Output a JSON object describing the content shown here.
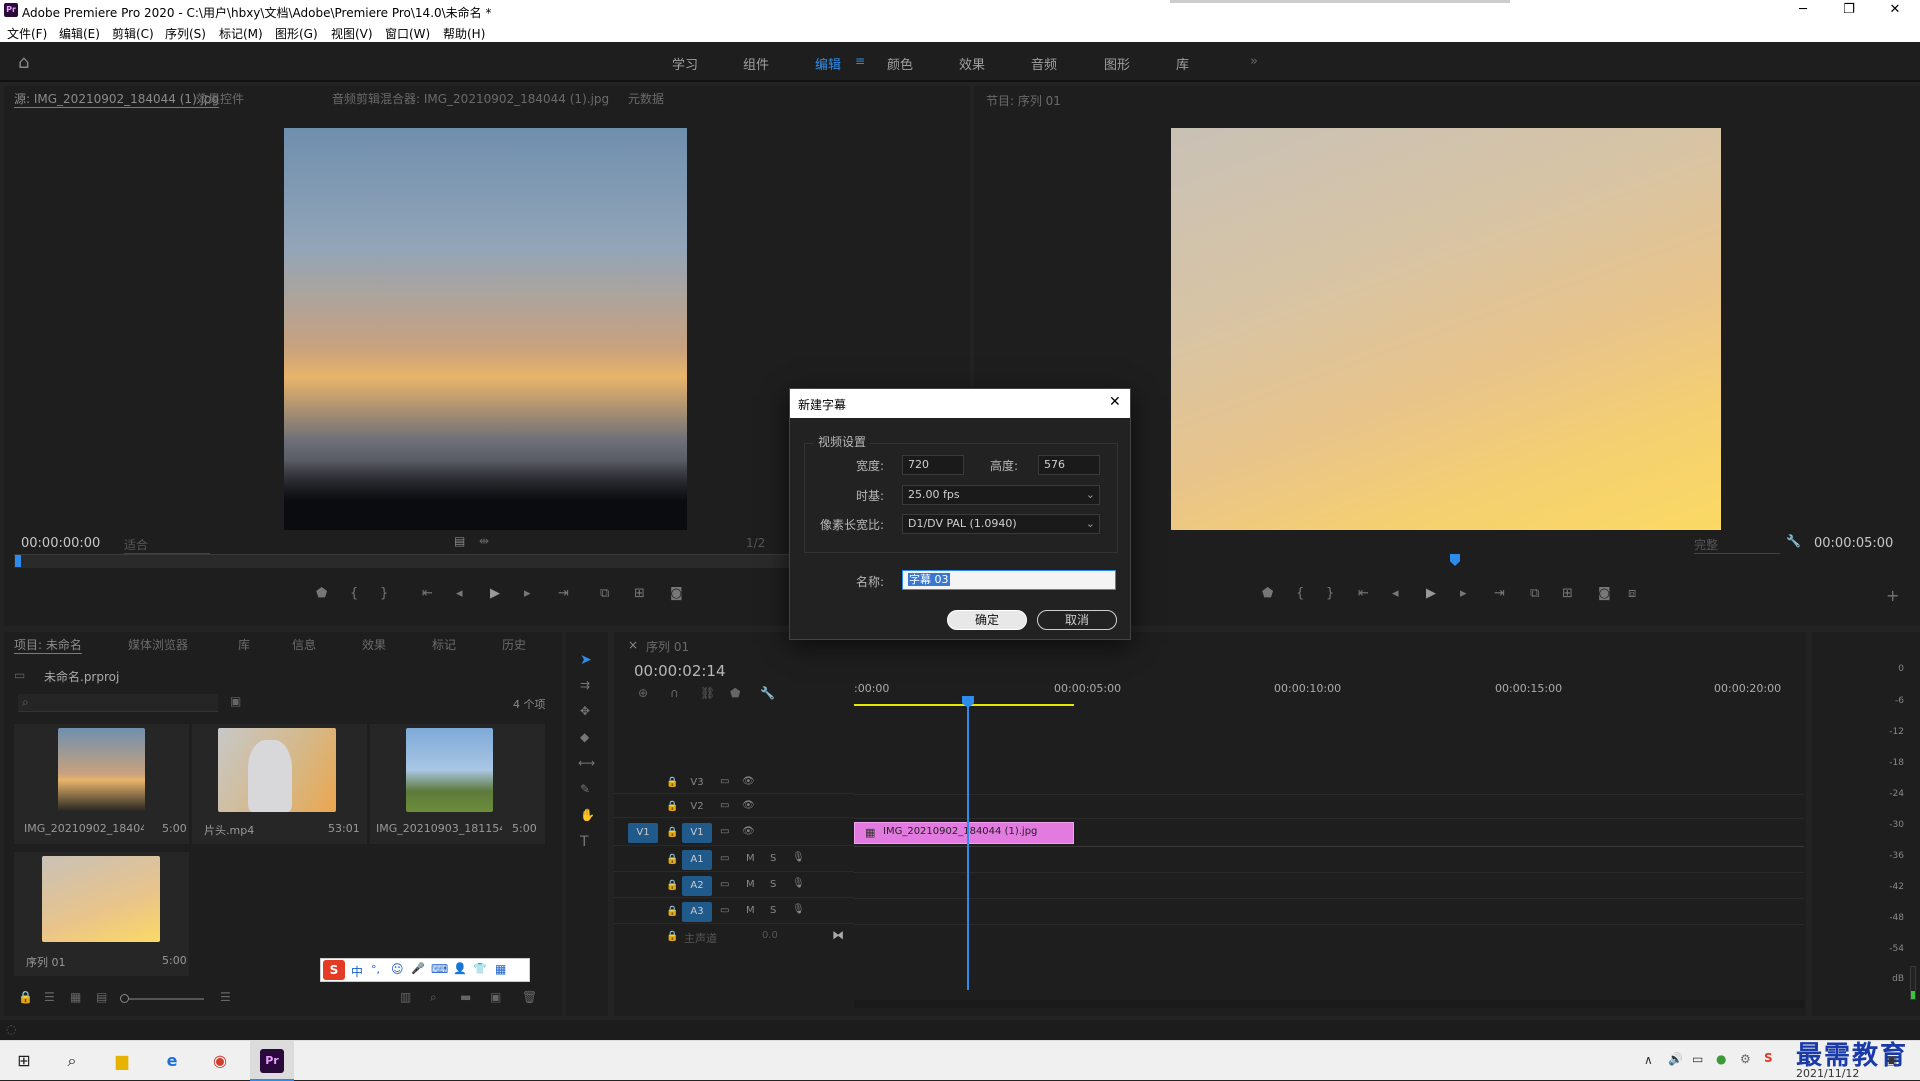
{
  "window": {
    "title": "Adobe Premiere Pro 2020 - C:\\用户\\hbxy\\文档\\Adobe\\Premiere Pro\\14.0\\未命名 *",
    "app_icon": "Pr"
  },
  "menu": [
    "文件(F)",
    "编辑(E)",
    "剪辑(C)",
    "序列(S)",
    "标记(M)",
    "图形(G)",
    "视图(V)",
    "窗口(W)",
    "帮助(H)"
  ],
  "workspaces": [
    "学习",
    "组件",
    "编辑",
    "颜色",
    "效果",
    "音频",
    "图形",
    "库"
  ],
  "active_workspace": "编辑",
  "source_monitor": {
    "tabs": [
      "源: IMG_20210902_184044 (1).jpg",
      "效果控件",
      "音频剪辑混合器: IMG_20210902_184044 (1).jpg",
      "元数据"
    ],
    "timecode": "00:00:00:00",
    "fit": "适合",
    "zoom": "1/2"
  },
  "program_monitor": {
    "tab": "节目: 序列 01",
    "timecode": "00:00:05:00",
    "quality": "完整"
  },
  "project": {
    "tabs": [
      "项目: 未命名",
      "媒体浏览器",
      "库",
      "信息",
      "效果",
      "标记",
      "历史"
    ],
    "file": "未命名.prproj",
    "count": "4 个项",
    "items": [
      {
        "name": "IMG_20210902_184044...",
        "dur": "5:00"
      },
      {
        "name": "片头.mp4",
        "dur": "53:01"
      },
      {
        "name": "IMG_20210903_181154...",
        "dur": "5:00"
      },
      {
        "name": "序列 01",
        "dur": "5:00"
      }
    ]
  },
  "timeline": {
    "tab": "序列 01",
    "timecode": "00:00:02:14",
    "ruler": [
      ":00:00",
      "00:00:05:00",
      "00:00:10:00",
      "00:00:15:00",
      "00:00:20:00"
    ],
    "video_tracks": [
      "V3",
      "V2",
      "V1"
    ],
    "audio_tracks": [
      "A1",
      "A2",
      "A3"
    ],
    "source_patch": "V1",
    "master": "主声道",
    "master_val": "0.0",
    "clip": "IMG_20210902_184044 (1).jpg"
  },
  "meter_ticks": [
    "0",
    "-6",
    "-12",
    "-18",
    "-24",
    "-30",
    "-36",
    "-42",
    "-48",
    "-54",
    "dB"
  ],
  "dialog": {
    "title": "新建字幕",
    "section": "视频设置",
    "width_label": "宽度:",
    "width": "720",
    "height_label": "高度:",
    "height": "576",
    "timebase_label": "时基:",
    "timebase": "25.00 fps",
    "par_label": "像素长宽比:",
    "par": "D1/DV PAL (1.0940)",
    "name_label": "名称:",
    "name": "字幕 03",
    "ok": "确定",
    "cancel": "取消"
  },
  "ime_bar": [
    "中",
    "°,",
    "☺",
    "🎤",
    "⌨",
    "👤",
    "👕",
    "▦"
  ],
  "taskbar": {
    "date": "2021/11/12",
    "watermark": "最需教育"
  },
  "colors": {
    "accent": "#2d8ceb",
    "clip": "#e27ae0",
    "inout": "#e6e600",
    "track_patch": "#1f5a8a"
  }
}
